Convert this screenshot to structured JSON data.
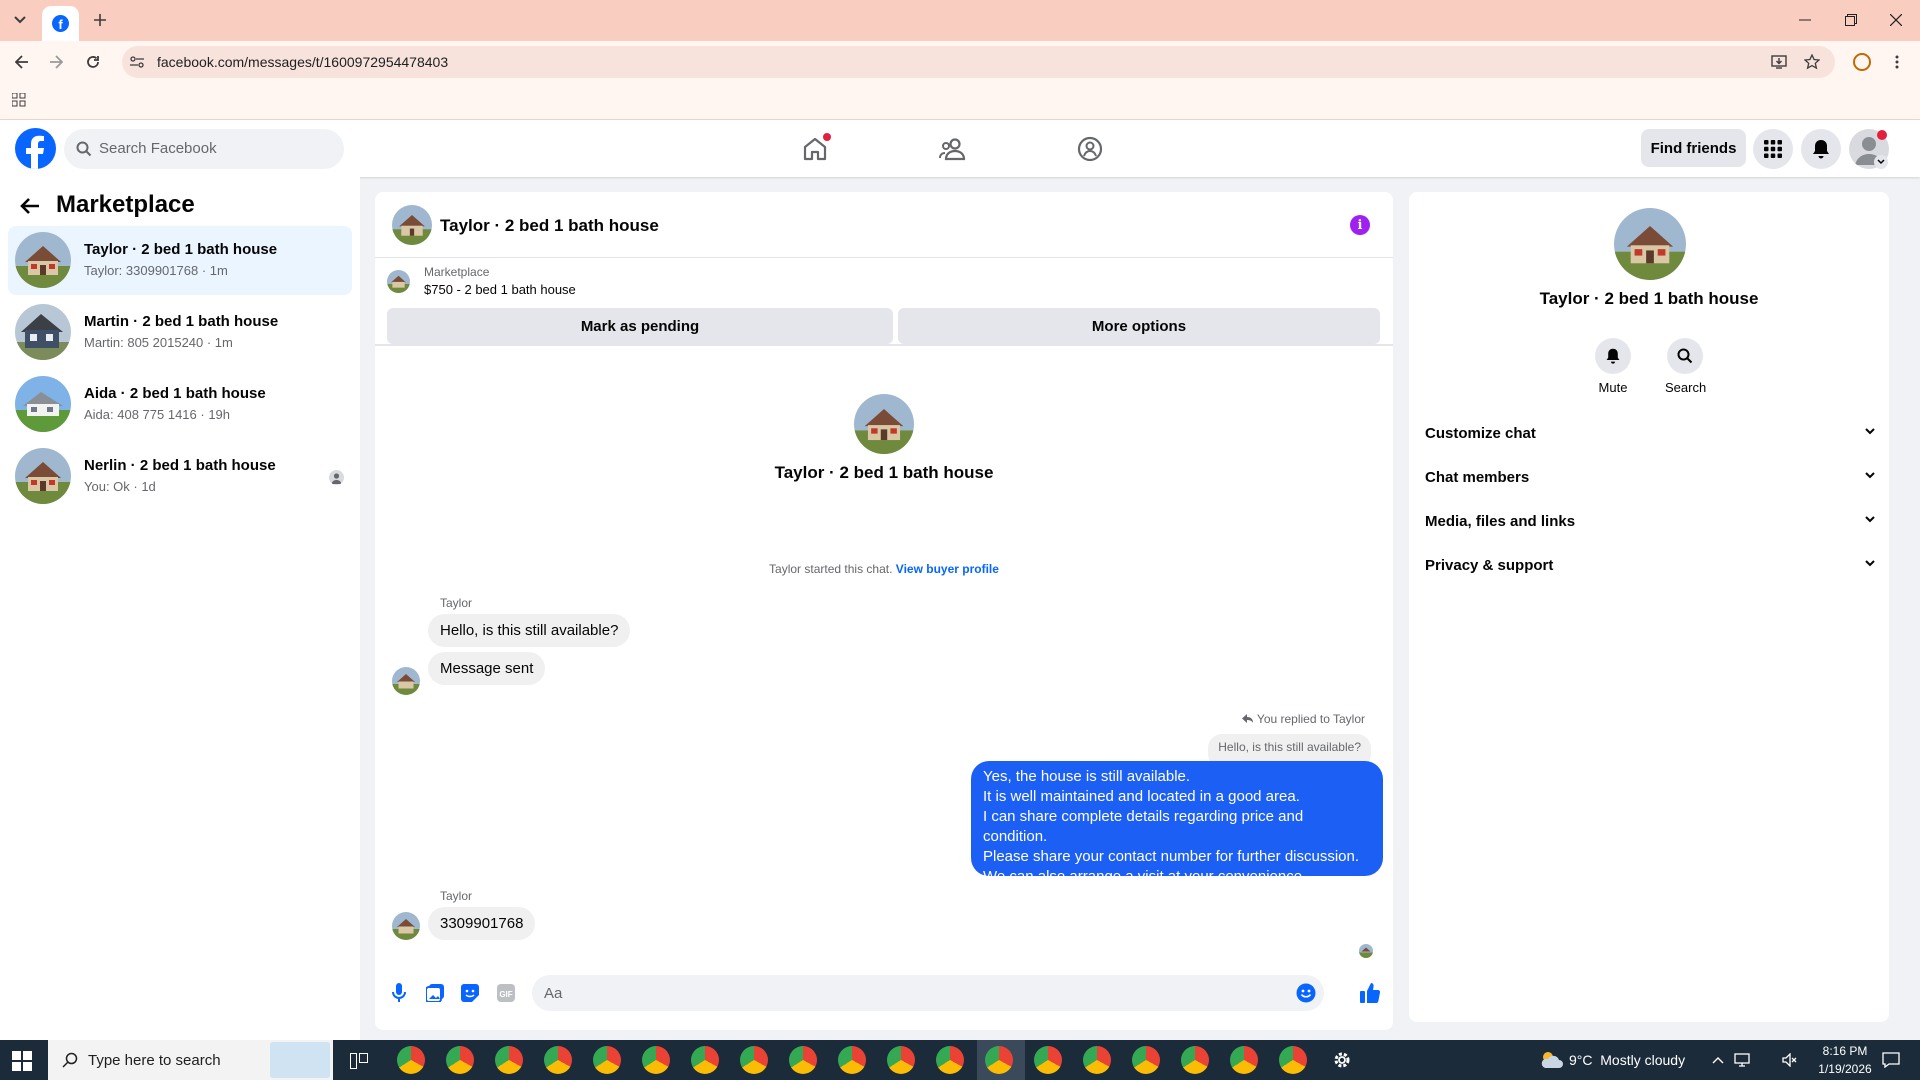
{
  "browser": {
    "url": "facebook.com/messages/t/1600972954478403"
  },
  "header": {
    "search_placeholder": "Search Facebook",
    "find_friends_label": "Find friends"
  },
  "sidebar": {
    "title": "Marketplace",
    "conversations": [
      {
        "name": "Taylor · 2 bed 1 bath house",
        "preview": "Taylor: 3309901768 · 1m",
        "selected": true
      },
      {
        "name": "Martin · 2 bed 1 bath house",
        "preview": "Martin: 805 2015240 · 1m"
      },
      {
        "name": "Aida · 2 bed 1 bath house",
        "preview": "Aida: 408 775 1416 · 19h"
      },
      {
        "name": "Nerlin · 2 bed 1 bath house",
        "preview": "You: Ok · 1d"
      }
    ]
  },
  "chat": {
    "title": "Taylor · 2 bed 1 bath house",
    "listing": {
      "source": "Marketplace",
      "summary": "$750 - 2 bed 1 bath house"
    },
    "mark_pending_label": "Mark as pending",
    "more_options_label": "More options",
    "intro_name": "Taylor · 2 bed 1 bath house",
    "started_text": "Taylor started this chat.",
    "view_buyer_label": "View buyer profile",
    "messages": {
      "sender1": "Taylor",
      "msg1": "Hello, is this still available?",
      "msg2": "Message sent",
      "replied_to": "You replied to Taylor",
      "quoted": "Hello, is this still available?",
      "reply_lines": [
        "Yes, the house is still available.",
        "It is well maintained and located in a good area.",
        "I can share complete details regarding price and condition.",
        "Please share your contact number for further discussion.",
        "We can also arrange a visit at your convenience."
      ],
      "sender2": "Taylor",
      "msg3": "3309901768"
    },
    "composer_placeholder": "Aa"
  },
  "details": {
    "title": "Taylor · 2 bed 1 bath house",
    "mute_label": "Mute",
    "search_label": "Search",
    "sections": [
      "Customize chat",
      "Chat members",
      "Media, files and links",
      "Privacy & support"
    ]
  },
  "taskbar": {
    "search_placeholder": "Type here to search",
    "weather": "9°C  Mostly cloudy",
    "time": "8:16 PM",
    "date": "1/19/2026"
  },
  "colors": {
    "accent": "#0866ff",
    "outgoing_bubble": "#1c5ff5",
    "info_icon": "#a020f0"
  }
}
